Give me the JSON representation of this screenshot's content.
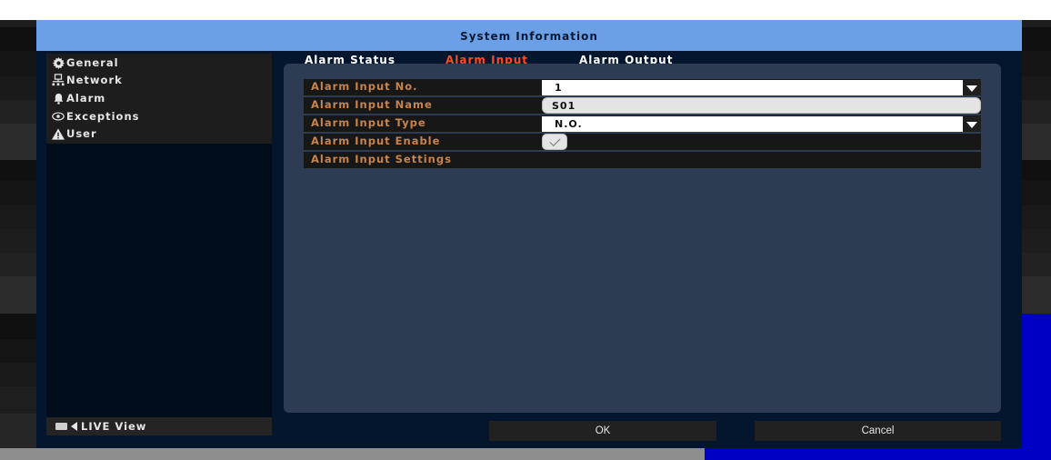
{
  "window": {
    "title": "System Information"
  },
  "sidebar": {
    "items": [
      {
        "label": "General",
        "icon": "gear-icon"
      },
      {
        "label": "Network",
        "icon": "network-icon"
      },
      {
        "label": "Alarm",
        "icon": "bell-icon"
      },
      {
        "label": "Exceptions",
        "icon": "eye-icon"
      },
      {
        "label": "User",
        "icon": "warning-icon"
      }
    ],
    "live_view": {
      "label": "LIVE View",
      "icon": "camera-icon"
    }
  },
  "tabs": [
    {
      "label": "Alarm Status",
      "active": false
    },
    {
      "label": "Alarm Input",
      "active": true
    },
    {
      "label": "Alarm Output",
      "active": false
    }
  ],
  "form": {
    "input_no": {
      "label": "Alarm Input No.",
      "value": "1"
    },
    "input_name": {
      "label": "Alarm Input Name",
      "value": "S01"
    },
    "input_type": {
      "label": "Alarm Input Type",
      "value": "N.O."
    },
    "input_enable": {
      "label": "Alarm Input Enable",
      "checked": true
    },
    "input_settings": {
      "label": "Alarm Input Settings"
    }
  },
  "buttons": {
    "ok": "OK",
    "cancel": "Cancel"
  },
  "colors": {
    "titlebar": "#6b9fe6",
    "active_tab": "#ff4a1c",
    "label": "#c8844a",
    "panel": "#2d3c52"
  }
}
